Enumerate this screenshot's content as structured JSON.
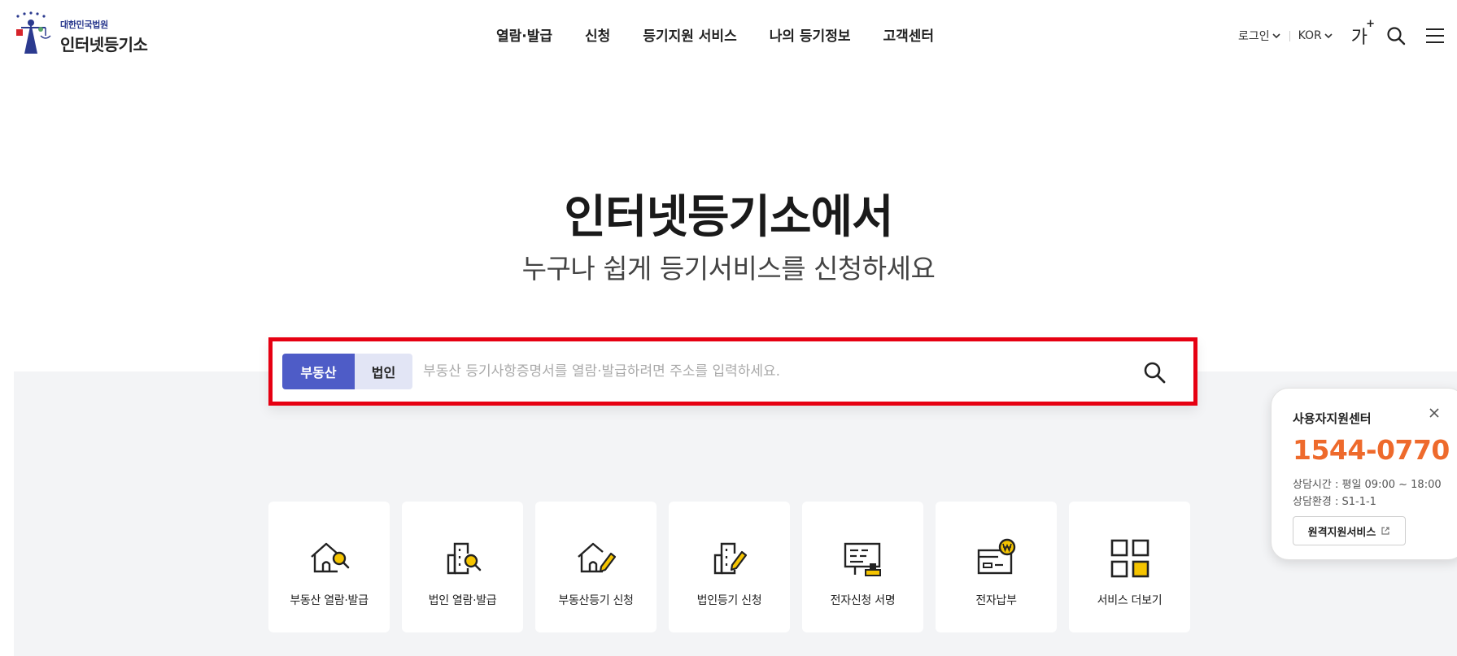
{
  "header": {
    "logo_sub": "대한민국법원",
    "logo_main": "인터넷등기소",
    "nav": [
      "열람·발급",
      "신청",
      "등기지원 서비스",
      "나의 등기정보",
      "고객센터"
    ],
    "login_label": "로그인",
    "lang_label": "KOR",
    "font_size_label": "가",
    "font_size_sup": "+",
    "icons": {
      "search": "search-icon",
      "menu": "hamburger-menu-icon",
      "chevron": "chevron-down-icon"
    }
  },
  "hero": {
    "title": "인터넷등기소에서",
    "subtitle": "누구나 쉽게 등기서비스를 신청하세요"
  },
  "search": {
    "tabs": [
      {
        "label": "부동산",
        "active": true
      },
      {
        "label": "법인",
        "active": false
      }
    ],
    "placeholder": "부동산 등기사항증명서를 열람·발급하려면 주소를 입력하세요.",
    "value": ""
  },
  "quick_menu": [
    {
      "label": "부동산 열람·발급",
      "icon": "house-search-icon"
    },
    {
      "label": "법인 열람·발급",
      "icon": "building-search-icon"
    },
    {
      "label": "부동산등기 신청",
      "icon": "house-pen-icon"
    },
    {
      "label": "법인등기 신청",
      "icon": "building-pen-icon"
    },
    {
      "label": "전자신청 서명",
      "icon": "document-stamp-icon"
    },
    {
      "label": "전자납부",
      "icon": "wallet-won-icon"
    },
    {
      "label": "서비스 더보기",
      "icon": "grid-more-icon"
    }
  ],
  "support": {
    "title": "사용자지원센터",
    "phone": "1544-0770",
    "hours": "상담시간 : 평일 09:00 ~ 18:00",
    "env": "상담환경 : S1-1-1",
    "remote_button": "원격지원서비스"
  },
  "colors": {
    "accent": "#4e5cc7",
    "tab_inactive": "#e2e5f5",
    "highlight_border": "#e60012",
    "phone": "#ee6a2c",
    "icon_yellow": "#f5c400",
    "band_bg": "#f3f4f6"
  }
}
